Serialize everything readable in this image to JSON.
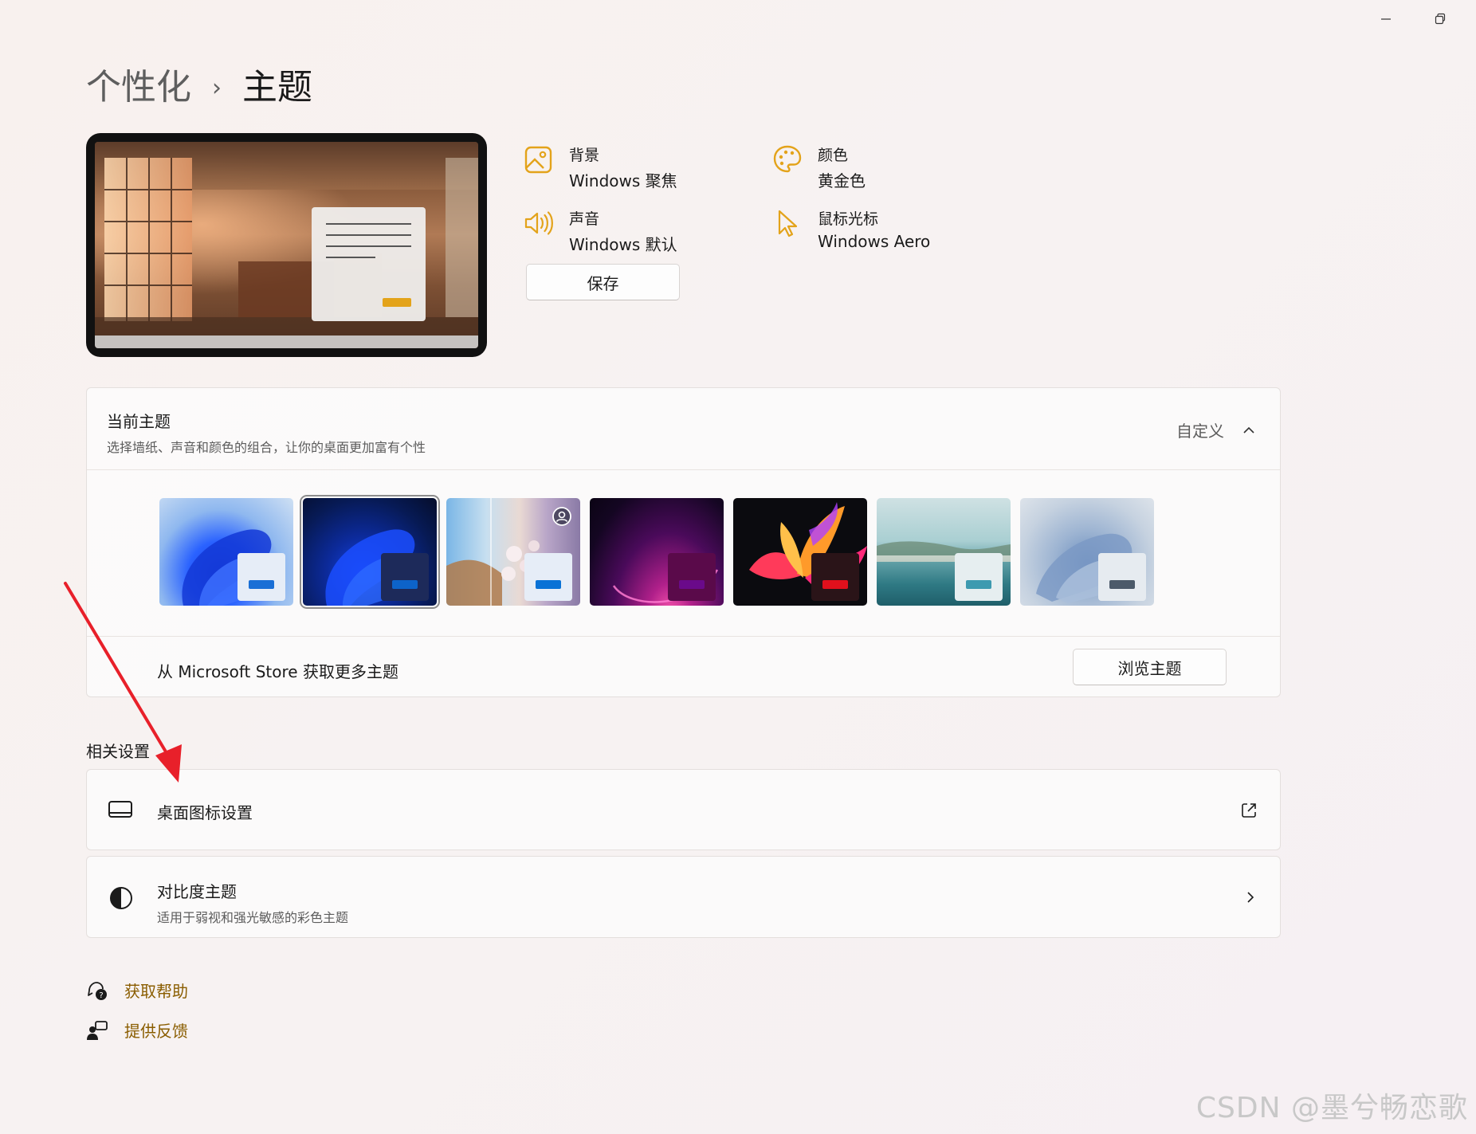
{
  "window": {
    "minimize_icon": "minimize-icon",
    "restore_icon": "restore-icon"
  },
  "breadcrumb": {
    "parent": "个性化",
    "separator": "›",
    "current": "主题"
  },
  "preview": {
    "accent_color": "#e3a31a"
  },
  "theme_props": {
    "background": {
      "label": "背景",
      "value": "Windows 聚焦",
      "icon": "image-icon"
    },
    "color": {
      "label": "颜色",
      "value": "黄金色",
      "icon": "palette-icon"
    },
    "sound": {
      "label": "声音",
      "value": "Windows 默认",
      "icon": "speaker-icon"
    },
    "cursor": {
      "label": "鼠标光标",
      "value": "Windows Aero",
      "icon": "cursor-icon"
    },
    "accent_color": "#e3a31a"
  },
  "save_button": "保存",
  "current_theme": {
    "title": "当前主题",
    "subtitle": "选择墙纸、声音和颜色的组合，让你的桌面更加富有个性",
    "value": "自定义",
    "themes": [
      {
        "name": "windows-light",
        "bar_color": "#1a6fd6",
        "selected": false
      },
      {
        "name": "windows-dark",
        "bar_color": "#0d63c9",
        "selected": true
      },
      {
        "name": "windows-spotlight",
        "bar_color": "#0a72d6",
        "selected": false
      },
      {
        "name": "glow",
        "bar_color": "#6a0a8a",
        "selected": false
      },
      {
        "name": "captured-motion",
        "bar_color": "#e0101c",
        "selected": false
      },
      {
        "name": "sunrise",
        "bar_color": "#3d9ab0",
        "selected": false
      },
      {
        "name": "flow",
        "bar_color": "#4c5a6a",
        "selected": false
      }
    ],
    "store_text": "从 Microsoft Store 获取更多主题",
    "browse_button": "浏览主题"
  },
  "related": {
    "heading": "相关设置",
    "desktop_icons": {
      "label": "桌面图标设置"
    },
    "contrast": {
      "title": "对比度主题",
      "subtitle": "适用于弱视和强光敏感的彩色主题"
    }
  },
  "links": {
    "help": "获取帮助",
    "feedback": "提供反馈",
    "color": "#8a5d00"
  },
  "annotation": {
    "arrow_color": "#e8202a"
  },
  "watermark": "CSDN @墨兮畅恋歌"
}
